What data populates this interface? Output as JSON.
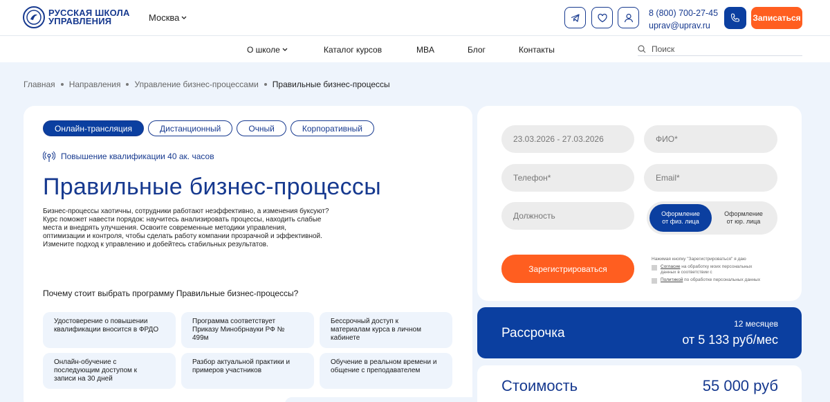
{
  "header": {
    "logo_line1": "РУССКАЯ ШКОЛА",
    "logo_line2": "УПРАВЛЕНИЯ",
    "city": "Москва",
    "phone": "8 (800) 700-27-45",
    "email": "uprav@uprav.ru",
    "signup_label": "Записаться",
    "icons": [
      "telegram-icon",
      "heart-icon",
      "user-icon",
      "phone-icon"
    ]
  },
  "nav": {
    "items": [
      "О школе",
      "Каталог курсов",
      "MBA",
      "Блог",
      "Контакты"
    ],
    "search_placeholder": "Поиск"
  },
  "breadcrumbs": [
    "Главная",
    "Направления",
    "Управление бизнес-процессами",
    "Правильные бизнес-процессы"
  ],
  "course": {
    "tabs": [
      "Онлайн-трансляция",
      "Дистанционный",
      "Очный",
      "Корпоративный"
    ],
    "active_tab": "Онлайн-трансляция",
    "qualification": "Повышение квалификации 40 ак. часов",
    "title": "Правильные бизнес-процессы",
    "description_lines": [
      "Бизнес-процессы хаотичны, сотрудники работают неэффективно, а изменения буксуют?",
      "Курс поможет навести порядок: научитесь анализировать процессы, находить слабые",
      "места и внедрять улучшения. Освоите современные методики управления,",
      "оптимизации и контроля, чтобы сделать работу компании прозрачной и эффективной.",
      "Измените подход к управлению и добейтесь стабильных результатов."
    ],
    "why_heading": "Почему стоит выбрать программу Правильные бизнес-процессы?",
    "features": [
      [
        "Удостоверение о повышении",
        "квалификации вносится в ФРДО"
      ],
      [
        "Программа соответствует",
        "Приказу Минобрнауки РФ №",
        "499м"
      ],
      [
        "Бессрочный доступ к",
        "материалам курса в личном",
        "кабинете"
      ],
      [
        "Онлайн-обучение с",
        "последующим доступом к",
        "записи на 30 дней"
      ],
      [
        "Разбор актуальной практики и",
        "примеров участников"
      ],
      [
        "Обучение в реальном времени и",
        "общение с преподавателем"
      ]
    ]
  },
  "form": {
    "date": "23.03.2026 - 27.03.2026",
    "fio_placeholder": "ФИО*",
    "phone_placeholder": "Телефон*",
    "email_placeholder": "Email*",
    "position_placeholder": "Должность",
    "toggle_on": [
      "Оформление",
      "от физ. лица"
    ],
    "toggle_off": [
      "Оформление",
      "от юр. лица"
    ],
    "register_label": "Зарегистрироваться",
    "consent_intro": "Нажимая кнопку \"Зарегистрироваться\" я даю",
    "consent1_link": "Согласие",
    "consent1_rest_a": " на обработку моих персональных",
    "consent1_rest_b": "данных в соответствии с",
    "consent2_link": "Политикой",
    "consent2_rest": " по обработке персональных данных"
  },
  "installment": {
    "label": "Рассрочка",
    "months": "12 месяцев",
    "amount": "от 5 133 руб/мес"
  },
  "price": {
    "label": "Стоимость",
    "value": "55 000 руб"
  },
  "colors": {
    "brand_blue": "#0b3fa0",
    "accent_orange": "#ff5e20",
    "background": "#eef4fc"
  }
}
